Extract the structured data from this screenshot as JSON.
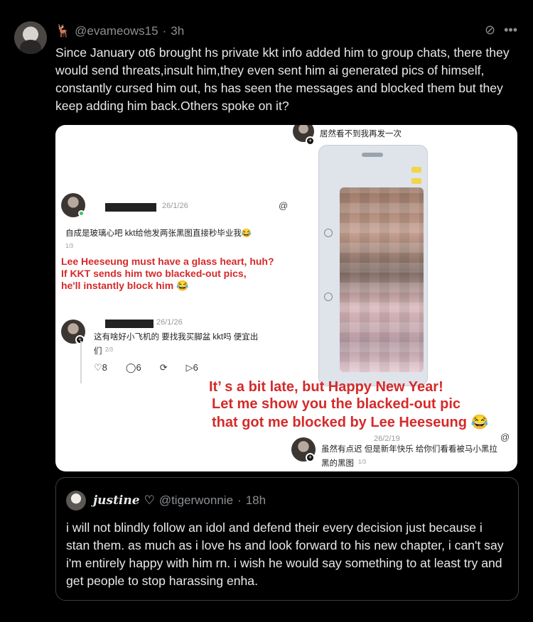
{
  "post": {
    "handle": "@evameows15",
    "separator": "·",
    "time": "3h",
    "text": "Since January ot6 brought hs private kkt info added him to group chats, there they would send threats,insult him,they even sent him ai generated pics of himself, constantly cursed him out, hs has seen the messages and blocked them but they keep adding him back.Others spoke on it?"
  },
  "icons": {
    "emoji": "deer",
    "top_right": [
      "grok-icon",
      "more-icon"
    ]
  },
  "media": {
    "top_caption": "居然看不到我再发一次",
    "c1": {
      "date": "26/1/26",
      "chinese": "自成是玻璃心吧 kkt给他发两张黑图直接秒毕业我😂",
      "page": "1/3",
      "english_1": "Lee Heeseung must have a glass heart, huh?",
      "english_2": "If KKT sends him two blacked-out pics,",
      "english_3": "he'll instantly block him 😂"
    },
    "c2": {
      "date": "26/1/26",
      "chinese_1": "这有啥好小飞机的 要找我买脚盆 kkt吗 便宜出",
      "chinese_2": "们",
      "page": "2/3",
      "likes": "8",
      "replies": "6",
      "shares": "6"
    },
    "c3": {
      "english_1": "It’ s a bit late, but Happy New Year!",
      "english_2": "Let me show you the blacked-out pic",
      "english_3": "that got me blocked by Lee Heeseung 😂",
      "date": "26/2/19",
      "chinese_1": "虽然有点迟 但是新年快乐 给你们看看被马小黑拉",
      "chinese_2": "黑的黑图",
      "page": "1/3"
    }
  },
  "quote": {
    "name": "justine",
    "heart": "♡",
    "handle": "@tigerwonnie",
    "separator": "·",
    "time": "18h",
    "text": "i will not blindly follow an idol and defend their every decision just because i stan them. as much as i love hs and look forward to his new chapter, i can't say i'm entirely happy with him rn. i wish he would say something to at least try and get people to stop harassing enha."
  }
}
